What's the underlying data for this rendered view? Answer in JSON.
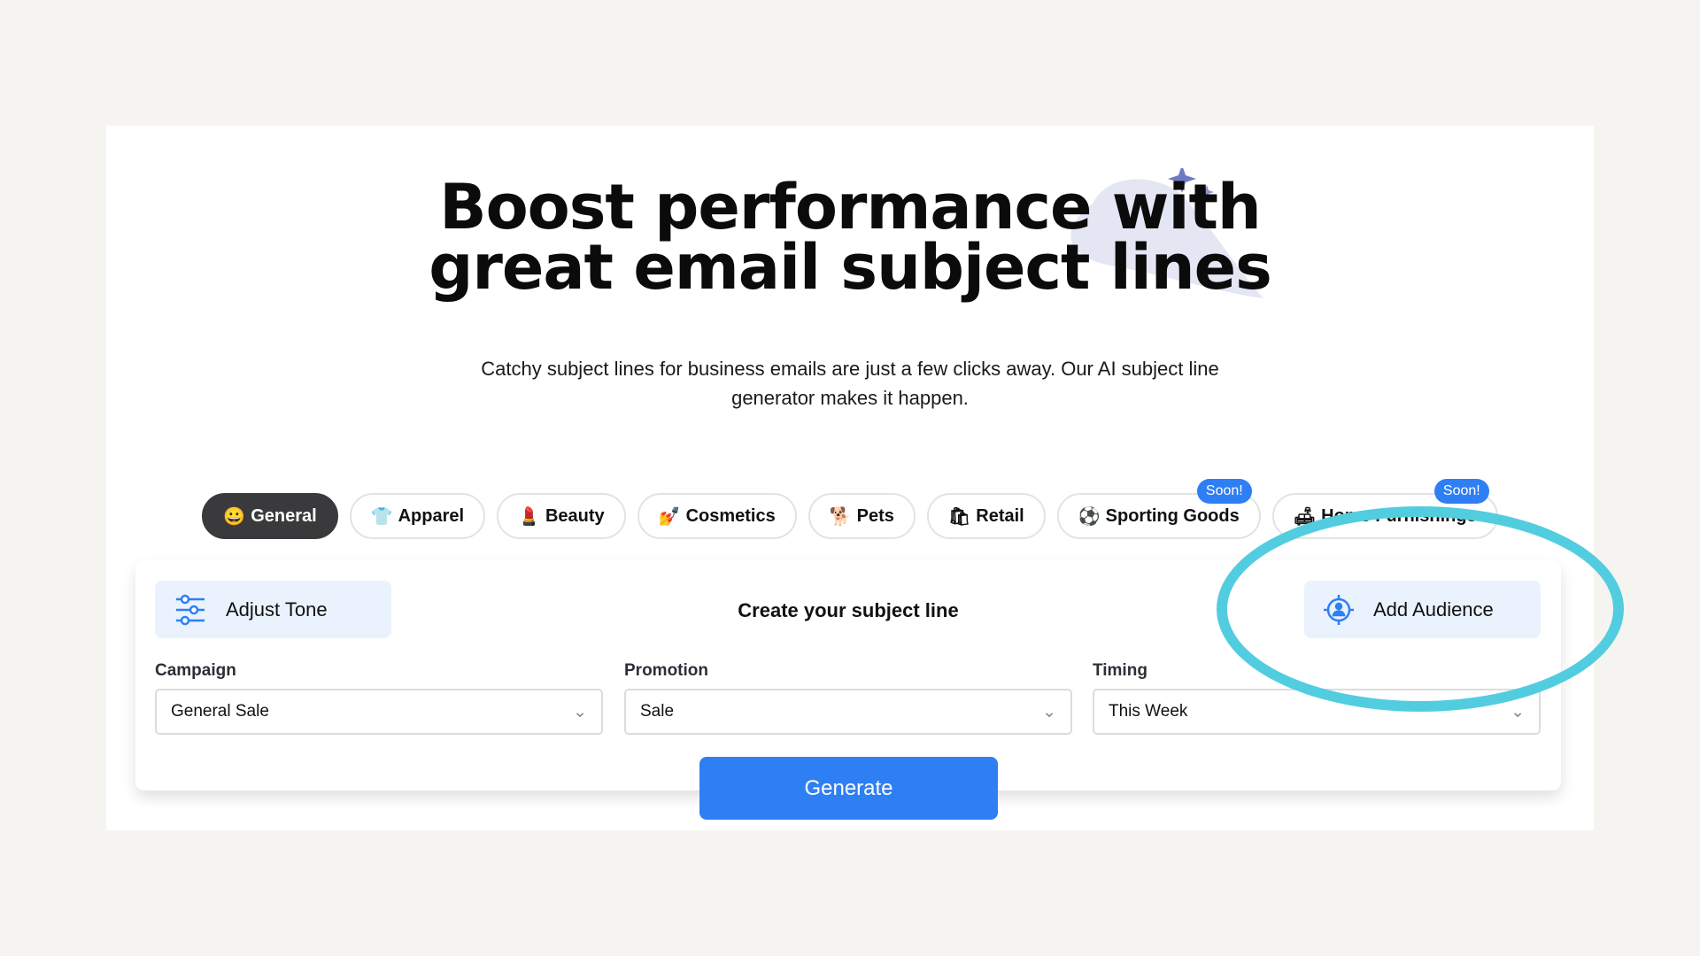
{
  "hero": {
    "title_line1": "Boost performance with",
    "title_line2": "great email subject lines",
    "subtitle_line1": "Catchy subject lines for business emails are just a few clicks away. Our AI subject line",
    "subtitle_line2": "generator makes it happen."
  },
  "categories": [
    {
      "emoji": "😀",
      "label": "General",
      "active": true
    },
    {
      "emoji": "👕",
      "label": "Apparel"
    },
    {
      "emoji": "💄",
      "label": "Beauty"
    },
    {
      "emoji": "💅",
      "label": "Cosmetics"
    },
    {
      "emoji": "🐕",
      "label": "Pets"
    },
    {
      "emoji": "🛍",
      "label": "Retail"
    },
    {
      "emoji": "⚽",
      "label": "Sporting Goods",
      "badge": "Soon!"
    },
    {
      "emoji": "🛋",
      "label": "Home Furnishings",
      "badge": "Soon!"
    }
  ],
  "card": {
    "adjust_tone": "Adjust Tone",
    "title": "Create your subject line",
    "add_audience": "Add Audience",
    "fields": [
      {
        "label": "Campaign",
        "value": "General Sale"
      },
      {
        "label": "Promotion",
        "value": "Sale"
      },
      {
        "label": "Timing",
        "value": "This Week"
      }
    ],
    "generate": "Generate"
  },
  "colors": {
    "accent": "#2f7ff4",
    "highlight": "#52cde0",
    "button_bg": "#eaf2fe"
  }
}
